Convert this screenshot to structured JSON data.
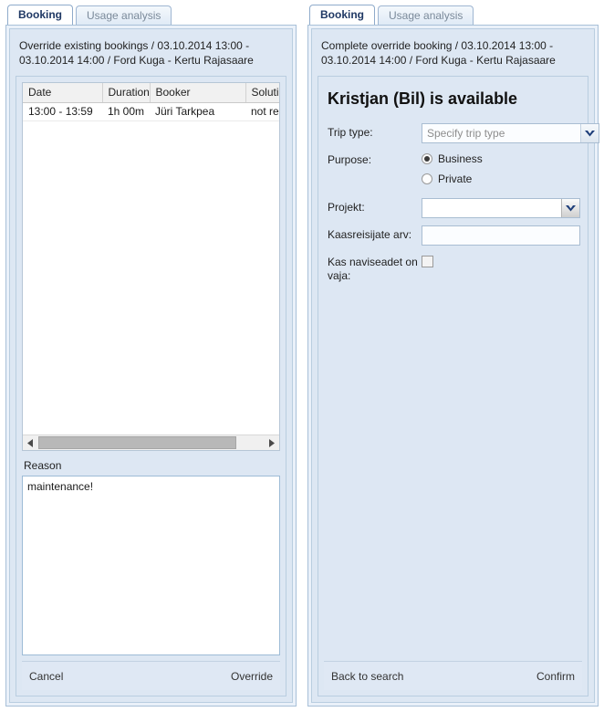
{
  "colors": {
    "tab_active_text": "#1f3864",
    "tab_inactive_text": "#7b8a9a",
    "panel_bg": "#dde7f3",
    "frame_bg": "#eaf1f9",
    "border": "#b9cde0",
    "footer_bg": "#dfe8f4"
  },
  "left_panel": {
    "tabs": [
      {
        "label": "Booking",
        "active": true
      },
      {
        "label": "Usage analysis",
        "active": false
      }
    ],
    "title": "Override existing bookings / 03.10.2014 13:00 - 03.10.2014 14:00 / Ford Kuga - Kertu Rajasaare",
    "grid": {
      "columns": [
        "Date",
        "Duration",
        "Booker",
        "Solution"
      ],
      "rows": [
        [
          "13:00 - 13:59",
          "1h 00m",
          "Jüri Tarkpea",
          "not rebook"
        ]
      ]
    },
    "scrollbar": {
      "left_arrow_icon": "triangle-left-icon",
      "right_arrow_icon": "triangle-right-icon"
    },
    "reason": {
      "label": "Reason",
      "value": "maintenance!",
      "placeholder": ""
    },
    "footer": {
      "cancel_label": "Cancel",
      "override_label": "Override"
    }
  },
  "right_panel": {
    "tabs": [
      {
        "label": "Booking",
        "active": true
      },
      {
        "label": "Usage analysis",
        "active": false
      }
    ],
    "title": "Complete override booking / 03.10.2014 13:00 - 03.10.2014 14:00 / Ford Kuga - Kertu Rajasaare",
    "availability_heading": "Kristjan (Bil) is available",
    "form": {
      "trip_type": {
        "label": "Trip type:",
        "value": "Specify trip type",
        "placeholder": "Specify trip type"
      },
      "purpose": {
        "label": "Purpose:",
        "options": [
          {
            "label": "Business",
            "selected": true
          },
          {
            "label": "Private",
            "selected": false
          }
        ]
      },
      "projekt": {
        "label": "Projekt:",
        "value": "",
        "placeholder": ""
      },
      "passengers": {
        "label": "Kaasreisijate arv:",
        "value": "",
        "placeholder": ""
      },
      "navigation_device": {
        "label": "Kas naviseadet on vaja:",
        "checked": false
      }
    },
    "footer": {
      "back_label": "Back to search",
      "confirm_label": "Confirm"
    }
  }
}
